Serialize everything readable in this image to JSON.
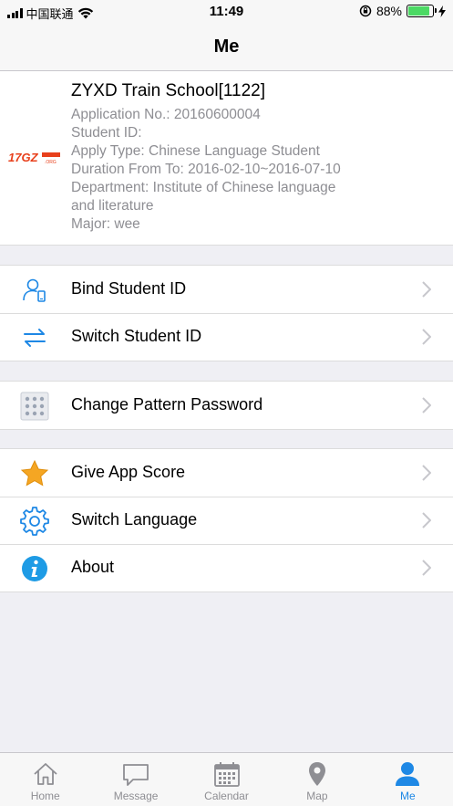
{
  "status_bar": {
    "carrier": "中国联通",
    "time": "11:49",
    "battery": "88%",
    "battery_level": 0.88
  },
  "nav": {
    "title": "Me"
  },
  "profile": {
    "logo_text": "17GZ",
    "logo_small": ".ORG",
    "school": "ZYXD Train School[1122]",
    "application_no": "Application No.: 20160600004",
    "student_id": "Student ID:",
    "apply_type": "Apply Type: Chinese Language Student",
    "duration": "Duration From To: 2016-02-10~2016-07-10",
    "department_line1": "Department: Institute of Chinese language",
    "department_line2": "and literature",
    "major": "Major: wee"
  },
  "menu": {
    "bind_student_id": "Bind Student ID",
    "switch_student_id": "Switch Student ID",
    "change_pattern_password": "Change Pattern Password",
    "give_app_score": "Give App Score",
    "switch_language": "Switch Language",
    "about": "About"
  },
  "tabs": {
    "home": "Home",
    "message": "Message",
    "calendar": "Calendar",
    "map": "Map",
    "me": "Me"
  },
  "colors": {
    "accent": "#1e88e5",
    "inactive": "#8e8e93",
    "icon_blue": "#1e88e5",
    "star": "#f5a623",
    "battery": "#4cd964"
  }
}
